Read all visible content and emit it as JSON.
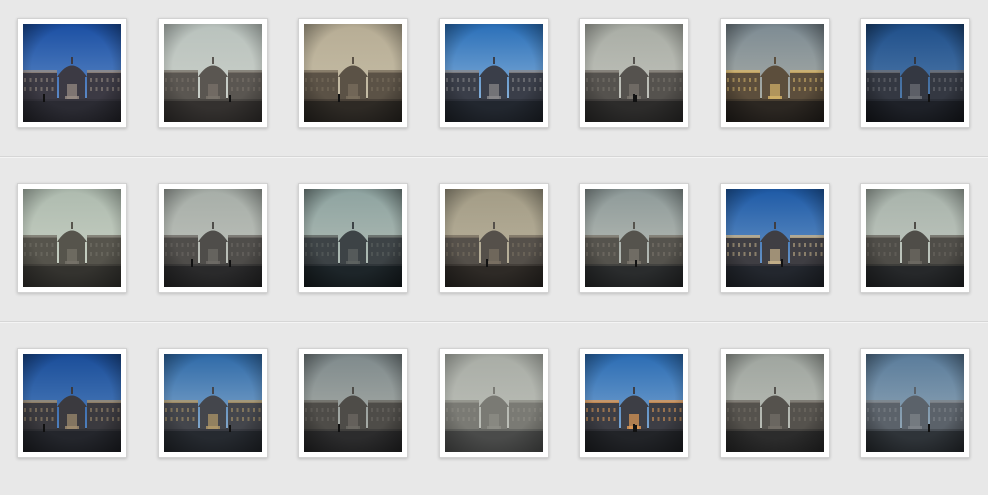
{
  "gallery": {
    "rows": [
      {
        "thumbnails": [
          {
            "filter": "deep-blue",
            "sky": "#1b4fa3",
            "sky_bottom": "#6f9ad0",
            "ground": "#2b2b33",
            "building": "#3c3a44",
            "lit": "#9a8f86",
            "vignette": 0.55
          },
          {
            "filter": "grey-fade",
            "sky": "#b9c2bd",
            "sky_bottom": "#cfd3cc",
            "ground": "#34312f",
            "building": "#5a5651",
            "lit": "#7b746b",
            "vignette": 0.45
          },
          {
            "filter": "sepia-fog",
            "sky": "#b7ad95",
            "sky_bottom": "#c9c1aa",
            "ground": "#2e2a25",
            "building": "#5b5246",
            "lit": "#7a6f5e",
            "vignette": 0.5
          },
          {
            "filter": "blue-clouds",
            "sky": "#2a6fb8",
            "sky_bottom": "#9fc2e3",
            "ground": "#22272f",
            "building": "#3a3e49",
            "lit": "#8b8a8c",
            "vignette": 0.5
          },
          {
            "filter": "grey-fade",
            "sky": "#a9ada5",
            "sky_bottom": "#c7c8c1",
            "ground": "#2d2c2b",
            "building": "#55524e",
            "lit": "#7a756e",
            "vignette": 0.45
          },
          {
            "filter": "warm-gold",
            "sky": "#7d8b93",
            "sky_bottom": "#b4b6ad",
            "ground": "#2c2722",
            "building": "#5c4e3c",
            "lit": "#d6b469",
            "vignette": 0.55
          },
          {
            "filter": "blue-night",
            "sky": "#1f4f8a",
            "sky_bottom": "#5e87b4",
            "ground": "#1e2128",
            "building": "#343842",
            "lit": "#6e7077",
            "vignette": 0.6
          }
        ]
      },
      {
        "thumbnails": [
          {
            "filter": "pale-green",
            "sky": "#aebbaf",
            "sky_bottom": "#cdd4c7",
            "ground": "#34332f",
            "building": "#56544c",
            "lit": "#77736a",
            "vignette": 0.45
          },
          {
            "filter": "grey-fade",
            "sky": "#a7aea8",
            "sky_bottom": "#c3c6bf",
            "ground": "#2a2a2b",
            "building": "#4f4d4a",
            "lit": "#6f6c66",
            "vignette": 0.5
          },
          {
            "filter": "teal-dark",
            "sky": "#8ea3a0",
            "sky_bottom": "#b9c3bb",
            "ground": "#1d2529",
            "building": "#3d4346",
            "lit": "#5f6462",
            "vignette": 0.6
          },
          {
            "filter": "sepia-fog",
            "sky": "#a39c86",
            "sky_bottom": "#bfb7a1",
            "ground": "#2e2a26",
            "building": "#55504a",
            "lit": "#7a7163",
            "vignette": 0.5
          },
          {
            "filter": "grey-clouds",
            "sky": "#8e9a99",
            "sky_bottom": "#c2c5bd",
            "ground": "#2a2c2d",
            "building": "#55534d",
            "lit": "#7c776d",
            "vignette": 0.5
          },
          {
            "filter": "blue-warm",
            "sky": "#1e5aa6",
            "sky_bottom": "#7aa3cf",
            "ground": "#23272e",
            "building": "#3f3e43",
            "lit": "#c9b48c",
            "vignette": 0.5
          },
          {
            "filter": "pale-green",
            "sky": "#a8b3ab",
            "sky_bottom": "#c6ccc3",
            "ground": "#26282a",
            "building": "#4f4d48",
            "lit": "#6d6a63",
            "vignette": 0.5
          }
        ]
      },
      {
        "thumbnails": [
          {
            "filter": "deep-blue",
            "sky": "#1a4d99",
            "sky_bottom": "#5f8fc7",
            "ground": "#24262c",
            "building": "#3b3a3f",
            "lit": "#a28e70",
            "vignette": 0.55
          },
          {
            "filter": "blue-clouds",
            "sky": "#2f6aa8",
            "sky_bottom": "#9bbad6",
            "ground": "#262a30",
            "building": "#44464c",
            "lit": "#b39a6a",
            "vignette": 0.5
          },
          {
            "filter": "grey-clouds",
            "sky": "#7f8a8c",
            "sky_bottom": "#b3b6af",
            "ground": "#2c2c2d",
            "building": "#4e4c48",
            "lit": "#6d6a64",
            "vignette": 0.55
          },
          {
            "filter": "fog-wash",
            "sky": "#a9ada6",
            "sky_bottom": "#c2c4bd",
            "ground": "#4a4b4a",
            "building": "#7a7a74",
            "lit": "#8f8e87",
            "vignette": 0.4
          },
          {
            "filter": "blue-orange",
            "sky": "#2b6cb3",
            "sky_bottom": "#8fb4d9",
            "ground": "#222428",
            "building": "#3d3e45",
            "lit": "#e09a55",
            "vignette": 0.5
          },
          {
            "filter": "grey-fade",
            "sky": "#9fa59f",
            "sky_bottom": "#c1c4bc",
            "ground": "#2c2c2c",
            "building": "#55524d",
            "lit": "#746f68",
            "vignette": 0.5
          },
          {
            "filter": "blue-fog",
            "sky": "#5a7c9b",
            "sky_bottom": "#9fb1bd",
            "ground": "#2f3439",
            "building": "#5b626a",
            "lit": "#7f858a",
            "vignette": 0.55
          }
        ]
      }
    ]
  }
}
